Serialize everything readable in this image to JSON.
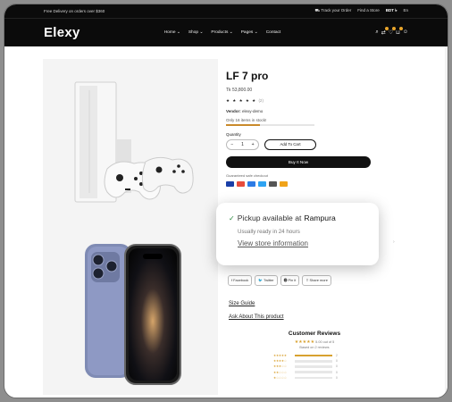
{
  "topbar": {
    "promo": "Free Delivery on orders over $360",
    "track": "Track your Order",
    "store": "Find a Store",
    "currency": "BDT ৳",
    "lang": "En"
  },
  "nav": {
    "logo": "Elexy",
    "menu": [
      "Home ⌄",
      "Shop ⌄",
      "Products ⌄",
      "Pages ⌄",
      "Contact"
    ]
  },
  "product": {
    "title": "LF 7 pro",
    "price": "Tk 53,800.00",
    "stars": "★ ★ ★ ★ ★",
    "review_count": "(2)",
    "vendor_label": "Vendor:",
    "vendor": "elexy-demo",
    "stock": "Only 16 items in stock!",
    "stock_fraction": 0.38,
    "quantity_label": "Quantity",
    "qty_minus": "−",
    "qty_value": "1",
    "qty_plus": "+",
    "add_to_cart": "Add To Cart",
    "buy_now": "Buy It Now",
    "guarantee": "Guaranteed safe checkout"
  },
  "payments": {
    "colors": [
      "#1a3fa8",
      "#e74c3c",
      "#2c7be5",
      "#2ea3f2",
      "#555555",
      "#f0a31a"
    ]
  },
  "pickup": {
    "check": "✓",
    "text": "Pickup available at",
    "location": "Rampura",
    "ready": "Usually ready in 24 hours",
    "link": "View store information"
  },
  "share": [
    "f Facebook",
    "🐦 Twitter",
    "⓿ Pin it",
    "⇪ Share more"
  ],
  "links": {
    "size_guide": "Size Guide",
    "ask": "Ask About This product"
  },
  "reviews": {
    "title": "Customer Reviews",
    "avg_stars": "★★★★★",
    "avg_text": "5.00 out of 5",
    "based": "Based on 2 reviews",
    "rows": [
      {
        "stars": "★★★★★",
        "fraction": 1.0,
        "count": "2"
      },
      {
        "stars": "★★★★☆",
        "fraction": 0,
        "count": "0"
      },
      {
        "stars": "★★★☆☆",
        "fraction": 0,
        "count": "0"
      },
      {
        "stars": "★★☆☆☆",
        "fraction": 0,
        "count": "0"
      },
      {
        "stars": "★☆☆☆☆",
        "fraction": 0,
        "count": "0"
      }
    ]
  }
}
